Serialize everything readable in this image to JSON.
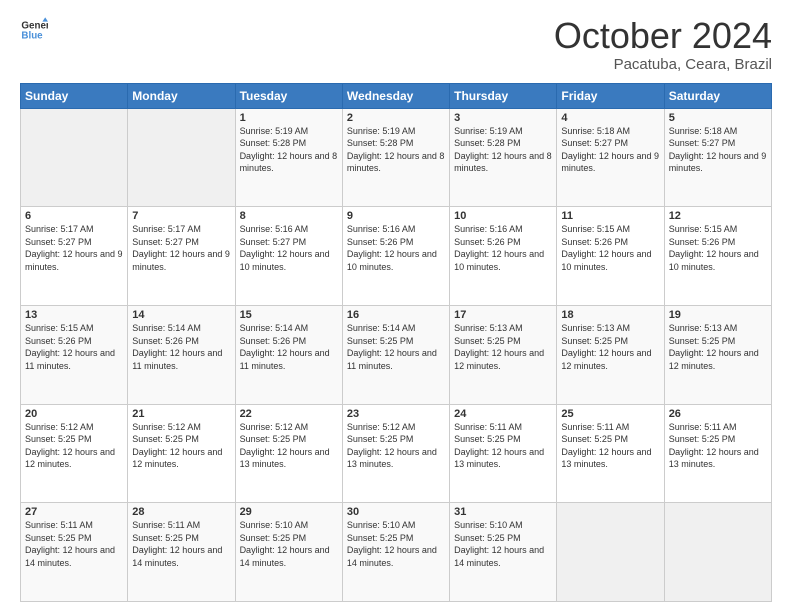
{
  "logo": {
    "line1": "General",
    "line2": "Blue"
  },
  "header": {
    "month": "October 2024",
    "location": "Pacatuba, Ceara, Brazil"
  },
  "weekdays": [
    "Sunday",
    "Monday",
    "Tuesday",
    "Wednesday",
    "Thursday",
    "Friday",
    "Saturday"
  ],
  "weeks": [
    [
      {
        "day": "",
        "sunrise": "",
        "sunset": "",
        "daylight": ""
      },
      {
        "day": "",
        "sunrise": "",
        "sunset": "",
        "daylight": ""
      },
      {
        "day": "1",
        "sunrise": "Sunrise: 5:19 AM",
        "sunset": "Sunset: 5:28 PM",
        "daylight": "Daylight: 12 hours and 8 minutes."
      },
      {
        "day": "2",
        "sunrise": "Sunrise: 5:19 AM",
        "sunset": "Sunset: 5:28 PM",
        "daylight": "Daylight: 12 hours and 8 minutes."
      },
      {
        "day": "3",
        "sunrise": "Sunrise: 5:19 AM",
        "sunset": "Sunset: 5:28 PM",
        "daylight": "Daylight: 12 hours and 8 minutes."
      },
      {
        "day": "4",
        "sunrise": "Sunrise: 5:18 AM",
        "sunset": "Sunset: 5:27 PM",
        "daylight": "Daylight: 12 hours and 9 minutes."
      },
      {
        "day": "5",
        "sunrise": "Sunrise: 5:18 AM",
        "sunset": "Sunset: 5:27 PM",
        "daylight": "Daylight: 12 hours and 9 minutes."
      }
    ],
    [
      {
        "day": "6",
        "sunrise": "Sunrise: 5:17 AM",
        "sunset": "Sunset: 5:27 PM",
        "daylight": "Daylight: 12 hours and 9 minutes."
      },
      {
        "day": "7",
        "sunrise": "Sunrise: 5:17 AM",
        "sunset": "Sunset: 5:27 PM",
        "daylight": "Daylight: 12 hours and 9 minutes."
      },
      {
        "day": "8",
        "sunrise": "Sunrise: 5:16 AM",
        "sunset": "Sunset: 5:27 PM",
        "daylight": "Daylight: 12 hours and 10 minutes."
      },
      {
        "day": "9",
        "sunrise": "Sunrise: 5:16 AM",
        "sunset": "Sunset: 5:26 PM",
        "daylight": "Daylight: 12 hours and 10 minutes."
      },
      {
        "day": "10",
        "sunrise": "Sunrise: 5:16 AM",
        "sunset": "Sunset: 5:26 PM",
        "daylight": "Daylight: 12 hours and 10 minutes."
      },
      {
        "day": "11",
        "sunrise": "Sunrise: 5:15 AM",
        "sunset": "Sunset: 5:26 PM",
        "daylight": "Daylight: 12 hours and 10 minutes."
      },
      {
        "day": "12",
        "sunrise": "Sunrise: 5:15 AM",
        "sunset": "Sunset: 5:26 PM",
        "daylight": "Daylight: 12 hours and 10 minutes."
      }
    ],
    [
      {
        "day": "13",
        "sunrise": "Sunrise: 5:15 AM",
        "sunset": "Sunset: 5:26 PM",
        "daylight": "Daylight: 12 hours and 11 minutes."
      },
      {
        "day": "14",
        "sunrise": "Sunrise: 5:14 AM",
        "sunset": "Sunset: 5:26 PM",
        "daylight": "Daylight: 12 hours and 11 minutes."
      },
      {
        "day": "15",
        "sunrise": "Sunrise: 5:14 AM",
        "sunset": "Sunset: 5:26 PM",
        "daylight": "Daylight: 12 hours and 11 minutes."
      },
      {
        "day": "16",
        "sunrise": "Sunrise: 5:14 AM",
        "sunset": "Sunset: 5:25 PM",
        "daylight": "Daylight: 12 hours and 11 minutes."
      },
      {
        "day": "17",
        "sunrise": "Sunrise: 5:13 AM",
        "sunset": "Sunset: 5:25 PM",
        "daylight": "Daylight: 12 hours and 12 minutes."
      },
      {
        "day": "18",
        "sunrise": "Sunrise: 5:13 AM",
        "sunset": "Sunset: 5:25 PM",
        "daylight": "Daylight: 12 hours and 12 minutes."
      },
      {
        "day": "19",
        "sunrise": "Sunrise: 5:13 AM",
        "sunset": "Sunset: 5:25 PM",
        "daylight": "Daylight: 12 hours and 12 minutes."
      }
    ],
    [
      {
        "day": "20",
        "sunrise": "Sunrise: 5:12 AM",
        "sunset": "Sunset: 5:25 PM",
        "daylight": "Daylight: 12 hours and 12 minutes."
      },
      {
        "day": "21",
        "sunrise": "Sunrise: 5:12 AM",
        "sunset": "Sunset: 5:25 PM",
        "daylight": "Daylight: 12 hours and 12 minutes."
      },
      {
        "day": "22",
        "sunrise": "Sunrise: 5:12 AM",
        "sunset": "Sunset: 5:25 PM",
        "daylight": "Daylight: 12 hours and 13 minutes."
      },
      {
        "day": "23",
        "sunrise": "Sunrise: 5:12 AM",
        "sunset": "Sunset: 5:25 PM",
        "daylight": "Daylight: 12 hours and 13 minutes."
      },
      {
        "day": "24",
        "sunrise": "Sunrise: 5:11 AM",
        "sunset": "Sunset: 5:25 PM",
        "daylight": "Daylight: 12 hours and 13 minutes."
      },
      {
        "day": "25",
        "sunrise": "Sunrise: 5:11 AM",
        "sunset": "Sunset: 5:25 PM",
        "daylight": "Daylight: 12 hours and 13 minutes."
      },
      {
        "day": "26",
        "sunrise": "Sunrise: 5:11 AM",
        "sunset": "Sunset: 5:25 PM",
        "daylight": "Daylight: 12 hours and 13 minutes."
      }
    ],
    [
      {
        "day": "27",
        "sunrise": "Sunrise: 5:11 AM",
        "sunset": "Sunset: 5:25 PM",
        "daylight": "Daylight: 12 hours and 14 minutes."
      },
      {
        "day": "28",
        "sunrise": "Sunrise: 5:11 AM",
        "sunset": "Sunset: 5:25 PM",
        "daylight": "Daylight: 12 hours and 14 minutes."
      },
      {
        "day": "29",
        "sunrise": "Sunrise: 5:10 AM",
        "sunset": "Sunset: 5:25 PM",
        "daylight": "Daylight: 12 hours and 14 minutes."
      },
      {
        "day": "30",
        "sunrise": "Sunrise: 5:10 AM",
        "sunset": "Sunset: 5:25 PM",
        "daylight": "Daylight: 12 hours and 14 minutes."
      },
      {
        "day": "31",
        "sunrise": "Sunrise: 5:10 AM",
        "sunset": "Sunset: 5:25 PM",
        "daylight": "Daylight: 12 hours and 14 minutes."
      },
      {
        "day": "",
        "sunrise": "",
        "sunset": "",
        "daylight": ""
      },
      {
        "day": "",
        "sunrise": "",
        "sunset": "",
        "daylight": ""
      }
    ]
  ]
}
